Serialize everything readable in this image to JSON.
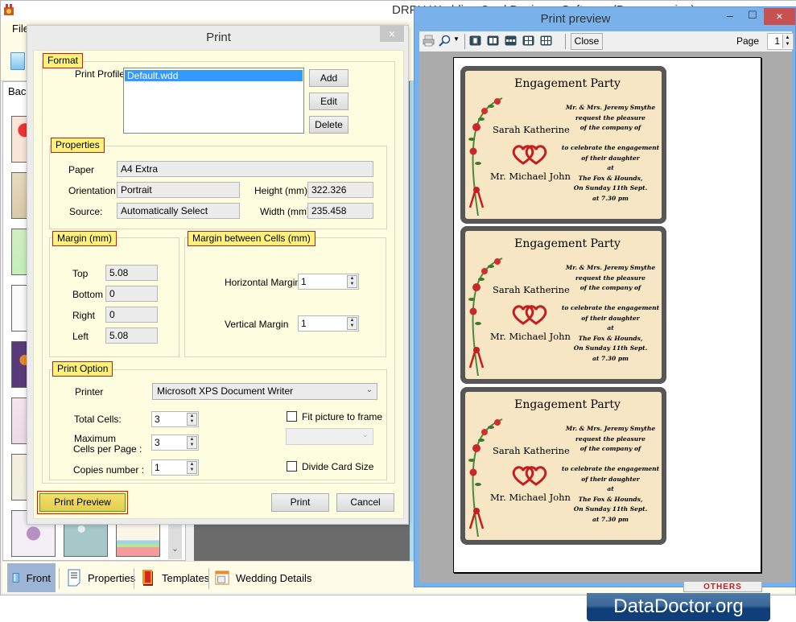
{
  "app": {
    "title": "DRPU Wedding Card Designer Software (Demo version)",
    "menu": {
      "file": "File"
    },
    "left_panel_title": "Background",
    "bottom_tabs": [
      {
        "label": "Front",
        "icon": "front-card-icon",
        "active": true
      },
      {
        "label": "Properties",
        "icon": "properties-icon",
        "active": false
      },
      {
        "label": "Templates",
        "icon": "templates-icon",
        "active": false
      },
      {
        "label": "Wedding Details",
        "icon": "wedding-details-icon",
        "active": false
      }
    ]
  },
  "print_dialog": {
    "title": "Print",
    "close_label": "×",
    "format": {
      "legend": "Format",
      "profile_label": "Print Profile",
      "profiles": [
        "Default.wdd"
      ],
      "selected_profile": "Default.wdd",
      "add_label": "Add",
      "edit_label": "Edit",
      "delete_label": "Delete"
    },
    "properties": {
      "legend": "Properties",
      "paper_label": "Paper",
      "paper_value": "A4 Extra",
      "orientation_label": "Orientation",
      "orientation_value": "Portrait",
      "source_label": "Source:",
      "source_value": "Automatically Select",
      "height_label": "Height (mm)",
      "height_value": "322.326",
      "width_label": "Width (mm)",
      "width_value": "235.458"
    },
    "margin": {
      "legend": "Margin (mm)",
      "top_label": "Top",
      "top_value": "5.08",
      "bottom_label": "Bottom",
      "bottom_value": "0",
      "right_label": "Right",
      "right_value": "0",
      "left_label": "Left",
      "left_value": "5.08"
    },
    "cell_margin": {
      "legend": "Margin between Cells (mm)",
      "horizontal_label": "Horizontal Margin",
      "horizontal_value": "1",
      "vertical_label": "Vertical Margin",
      "vertical_value": "1"
    },
    "print_option": {
      "legend": "Print Option",
      "printer_label": "Printer",
      "printer_value": "Microsoft XPS Document Writer",
      "total_cells_label": "Total Cells:",
      "total_cells_value": "3",
      "max_cells_label_1": "Maximum",
      "max_cells_label_2": "Cells per Page :",
      "max_cells_value": "3",
      "copies_label": "Copies number :",
      "copies_value": "1",
      "fit_picture_label": "Fit picture to frame",
      "fit_picture_checked": false,
      "divide_card_label": "Divide Card Size",
      "divide_card_checked": false
    },
    "print_preview_label": "Print Preview",
    "print_label": "Print",
    "cancel_label": "Cancel"
  },
  "preview_window": {
    "title": "Print preview",
    "minimize_label": "–",
    "maximize_label": "☐",
    "close_label": "×",
    "toolbar": {
      "close_label": "Close",
      "page_label": "Page",
      "page_value": "1"
    },
    "cards": [
      {
        "title": "Engagement Party",
        "name1": "Sarah Katherine",
        "name2": "Mr. Michael John",
        "lines": [
          "Mr. & Mrs. Jeremy Smythe",
          "request the pleasure",
          "of the company of",
          "",
          "to celebrate the engagement",
          "of their daughter",
          "at",
          "The Fox & Hounds,",
          "On Sunday 11th Sept.",
          "at 7.30 pm"
        ]
      },
      {
        "title": "Engagement Party",
        "name1": "Sarah Katherine",
        "name2": "Mr. Michael John",
        "lines": [
          "Mr. & Mrs. Jeremy Smythe",
          "request the pleasure",
          "of the company of",
          "",
          "to celebrate the engagement",
          "of their daughter",
          "at",
          "The Fox & Hounds,",
          "On Sunday 11th Sept.",
          "at 7.30 pm"
        ]
      },
      {
        "title": "Engagement Party",
        "name1": "Sarah Katherine",
        "name2": "Mr. Michael John",
        "lines": [
          "Mr. & Mrs. Jeremy Smythe",
          "request the pleasure",
          "of the company of",
          "",
          "to celebrate the engagement",
          "of their daughter",
          "at",
          "The Fox & Hounds,",
          "On Sunday 11th Sept.",
          "at 7.30 pm"
        ]
      }
    ]
  },
  "others_know": "OTHERS KNOW...",
  "brand": "DataDoctor.org"
}
